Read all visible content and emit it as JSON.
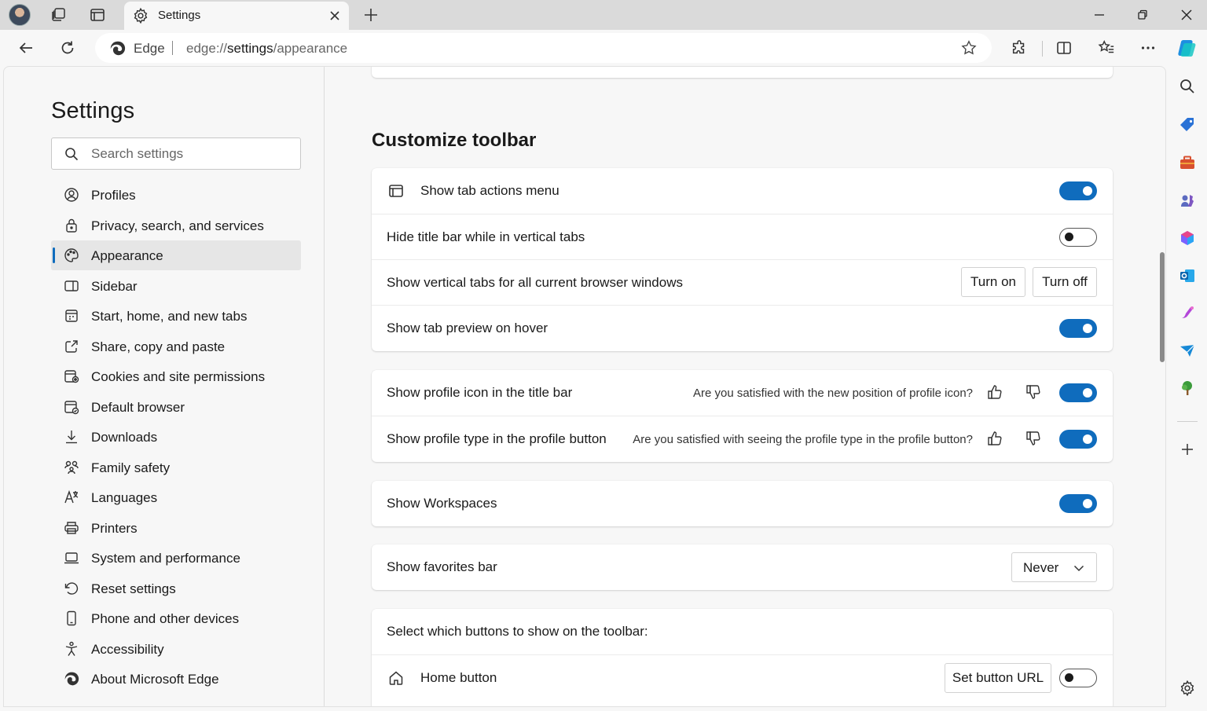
{
  "tab": {
    "title": "Settings"
  },
  "address": {
    "site_name": "Edge",
    "url_prefix": "edge://",
    "url_host": "settings",
    "url_path": "/appearance"
  },
  "sidebar": {
    "title": "Settings",
    "search_placeholder": "Search settings",
    "items": [
      {
        "label": "Profiles",
        "icon": "profiles-icon"
      },
      {
        "label": "Privacy, search, and services",
        "icon": "lock-icon"
      },
      {
        "label": "Appearance",
        "icon": "palette-icon",
        "active": true
      },
      {
        "label": "Sidebar",
        "icon": "sidebar-panel-icon"
      },
      {
        "label": "Start, home, and new tabs",
        "icon": "home-tabs-icon"
      },
      {
        "label": "Share, copy and paste",
        "icon": "share-icon"
      },
      {
        "label": "Cookies and site permissions",
        "icon": "cookies-icon"
      },
      {
        "label": "Default browser",
        "icon": "default-browser-icon"
      },
      {
        "label": "Downloads",
        "icon": "download-icon"
      },
      {
        "label": "Family safety",
        "icon": "family-icon"
      },
      {
        "label": "Languages",
        "icon": "languages-icon"
      },
      {
        "label": "Printers",
        "icon": "printer-icon"
      },
      {
        "label": "System and performance",
        "icon": "laptop-icon"
      },
      {
        "label": "Reset settings",
        "icon": "reset-icon"
      },
      {
        "label": "Phone and other devices",
        "icon": "phone-icon"
      },
      {
        "label": "Accessibility",
        "icon": "accessibility-icon"
      },
      {
        "label": "About Microsoft Edge",
        "icon": "edge-logo-icon"
      }
    ]
  },
  "main": {
    "section_title": "Customize toolbar",
    "tab_group": {
      "show_tab_actions": {
        "label": "Show tab actions menu",
        "on": true
      },
      "hide_title_bar": {
        "label": "Hide title bar while in vertical tabs",
        "on": false
      },
      "vertical_tabs": {
        "label": "Show vertical tabs for all current browser windows",
        "turn_on": "Turn on",
        "turn_off": "Turn off"
      },
      "tab_preview": {
        "label": "Show tab preview on hover",
        "on": true
      }
    },
    "profile_group": {
      "profile_icon": {
        "label": "Show profile icon in the title bar",
        "feedback": "Are you satisfied with the new position of profile icon?",
        "on": true
      },
      "profile_type": {
        "label": "Show profile type in the profile button",
        "feedback": "Are you satisfied with seeing the profile type in the profile button?",
        "on": true
      }
    },
    "workspaces": {
      "label": "Show Workspaces",
      "on": true
    },
    "favorites_bar": {
      "label": "Show favorites bar",
      "value": "Never"
    },
    "toolbar_buttons": {
      "heading": "Select which buttons to show on the toolbar:",
      "home_button": {
        "label": "Home button",
        "set_url": "Set button URL",
        "on": false
      }
    }
  },
  "colors": {
    "accent": "#0f6cbd",
    "tabstrip": "#dadada",
    "page_bg": "#f7f7f7"
  }
}
